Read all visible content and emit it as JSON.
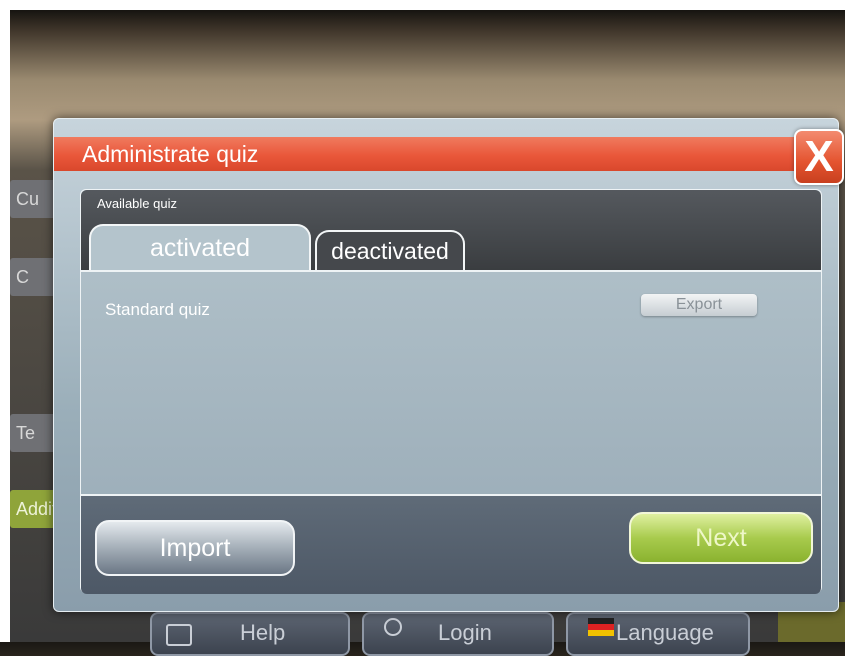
{
  "dialog": {
    "title": "Administrate quiz",
    "close_label": "X",
    "section_label": "Available quiz",
    "tabs": [
      {
        "label": "activated",
        "active": true
      },
      {
        "label": "deactivated",
        "active": false
      }
    ],
    "quizzes": [
      {
        "name": "Standard quiz",
        "action_label": "Export"
      }
    ],
    "import_label": "Import",
    "next_label": "Next"
  },
  "background": {
    "menu_items": [
      "Cu",
      "C",
      "Te",
      "Additio"
    ],
    "bottom_bar": {
      "help_label": "Help",
      "login_label": "Login",
      "language_label": "Language"
    }
  },
  "colors": {
    "title_bar": "#e9573a",
    "next_button": "#a8cb4d",
    "panel": "#b4c4cc"
  }
}
